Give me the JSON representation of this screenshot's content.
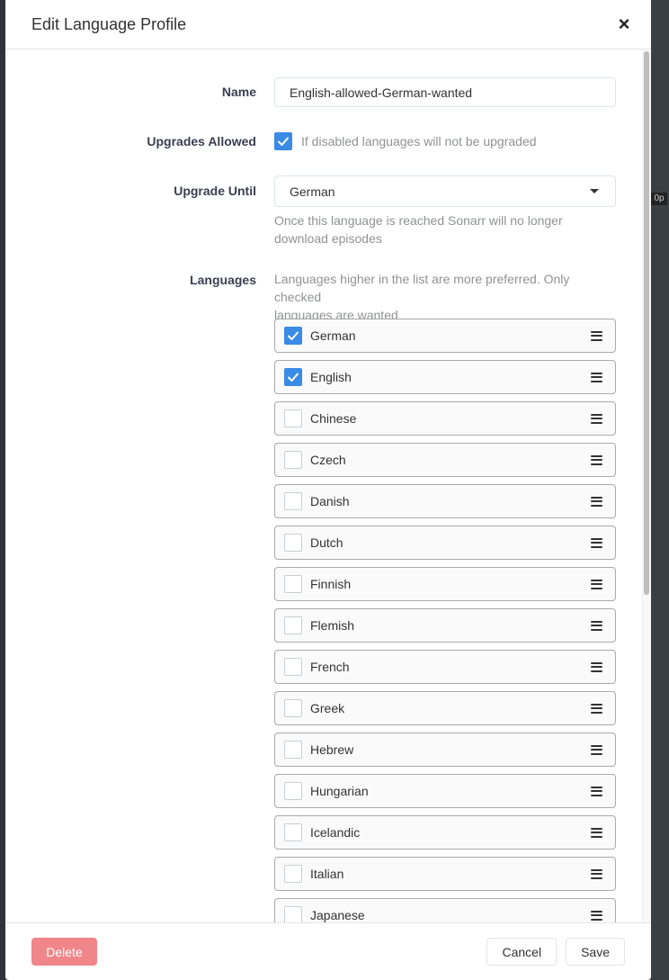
{
  "modal": {
    "title": "Edit Language Profile",
    "close_glyph": "×"
  },
  "form": {
    "name_label": "Name",
    "name_value": "English-allowed-German-wanted",
    "upgrades_label": "Upgrades Allowed",
    "upgrades_checked": true,
    "upgrades_help": "If disabled languages will not be upgraded",
    "upgrade_until_label": "Upgrade Until",
    "upgrade_until_value": "German",
    "upgrade_until_help_1": "Once this language is reached Sonarr will no longer",
    "upgrade_until_help_2": "download episodes",
    "languages_label": "Languages",
    "languages_help_1": "Languages higher in the list are more preferred. Only checked",
    "languages_help_2": "languages are wanted"
  },
  "languages": [
    {
      "name": "German",
      "checked": true
    },
    {
      "name": "English",
      "checked": true
    },
    {
      "name": "Chinese",
      "checked": false
    },
    {
      "name": "Czech",
      "checked": false
    },
    {
      "name": "Danish",
      "checked": false
    },
    {
      "name": "Dutch",
      "checked": false
    },
    {
      "name": "Finnish",
      "checked": false
    },
    {
      "name": "Flemish",
      "checked": false
    },
    {
      "name": "French",
      "checked": false
    },
    {
      "name": "Greek",
      "checked": false
    },
    {
      "name": "Hebrew",
      "checked": false
    },
    {
      "name": "Hungarian",
      "checked": false
    },
    {
      "name": "Icelandic",
      "checked": false
    },
    {
      "name": "Italian",
      "checked": false
    },
    {
      "name": "Japanese",
      "checked": false
    }
  ],
  "footer": {
    "delete_label": "Delete",
    "cancel_label": "Cancel",
    "save_label": "Save"
  },
  "background": {
    "badge_text": "0p"
  },
  "colors": {
    "accent": "#3a8be6",
    "danger": "#f0868a"
  }
}
